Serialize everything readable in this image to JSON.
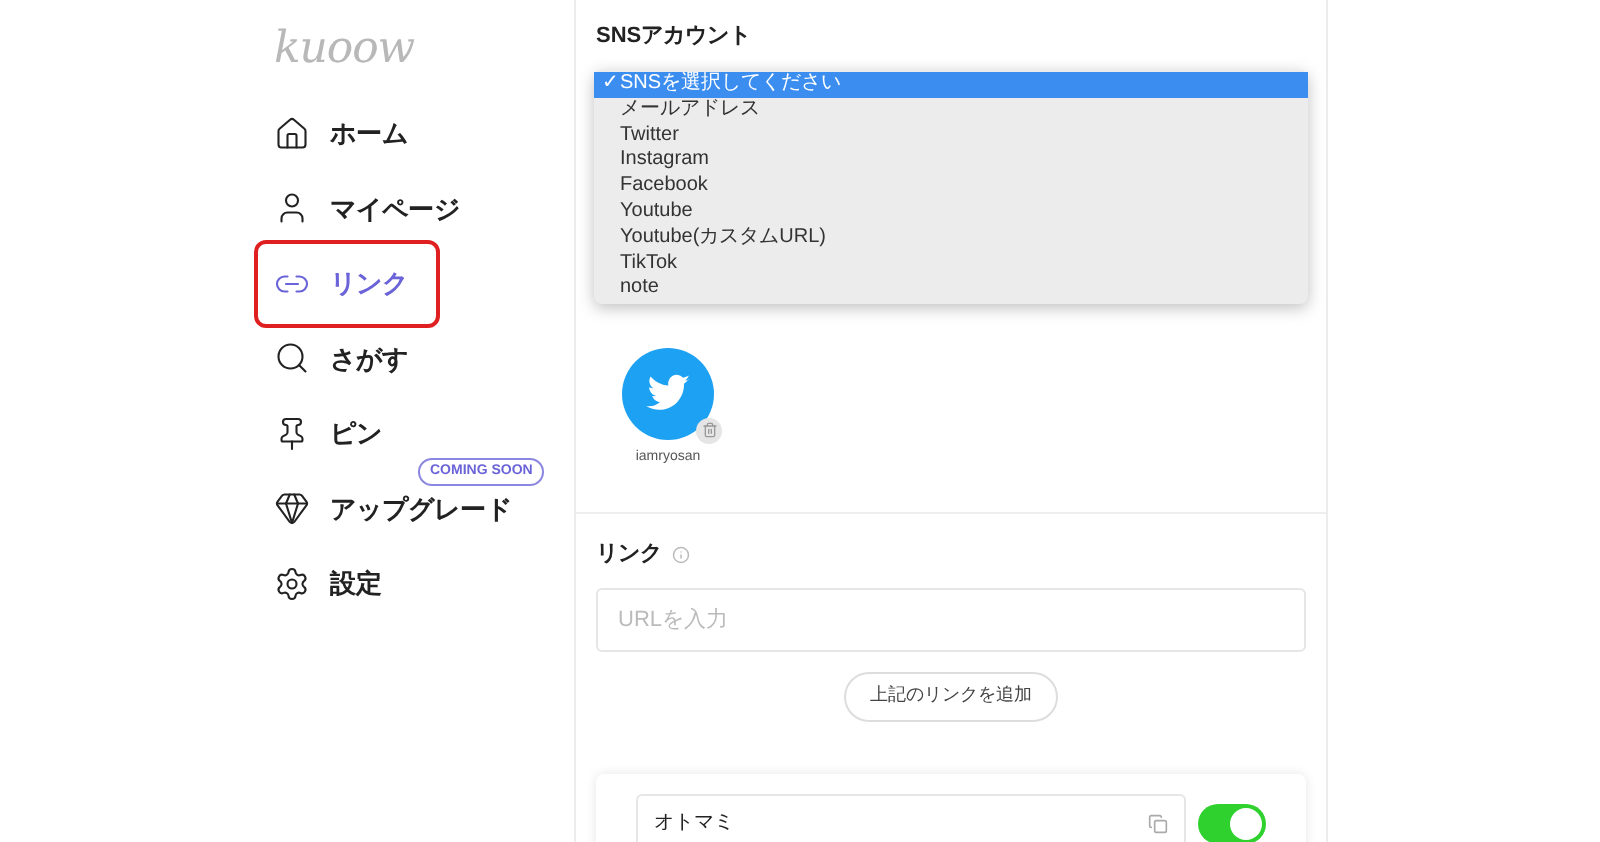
{
  "logo": "kuoow",
  "sidebar": {
    "items": [
      {
        "label": "ホーム",
        "selected": false
      },
      {
        "label": "マイページ",
        "selected": false
      },
      {
        "label": "リンク",
        "selected": true
      },
      {
        "label": "さがす",
        "selected": false
      },
      {
        "label": "ピン",
        "selected": false
      },
      {
        "label": "アップグレード",
        "selected": false,
        "badge": "COMING SOON"
      },
      {
        "label": "設定",
        "selected": false
      }
    ]
  },
  "sns_section": {
    "title": "SNSアカウント",
    "dropdown_options": [
      {
        "label": "SNSを選択してください",
        "selected": true,
        "check": "✓"
      },
      {
        "label": "メールアドレス",
        "selected": false
      },
      {
        "label": "Twitter",
        "selected": false
      },
      {
        "label": "Instagram",
        "selected": false
      },
      {
        "label": "Facebook",
        "selected": false
      },
      {
        "label": "Youtube",
        "selected": false
      },
      {
        "label": "Youtube(カスタムURL)",
        "selected": false
      },
      {
        "label": "TikTok",
        "selected": false
      },
      {
        "label": "note",
        "selected": false
      }
    ],
    "accounts": [
      {
        "kind": "twitter",
        "username": "iamryosan"
      }
    ]
  },
  "link_section": {
    "title": "リンク",
    "url_field": {
      "placeholder": "URLを入力"
    },
    "add_button": "上記のリンクを追加",
    "links": [
      {
        "title": "オトマミ",
        "on": true
      }
    ]
  }
}
